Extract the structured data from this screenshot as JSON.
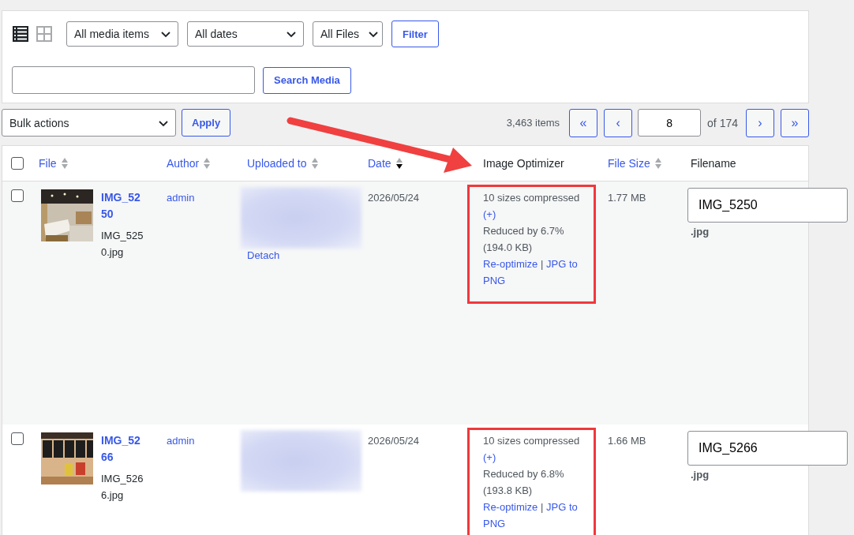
{
  "view_modes": [
    {
      "kind": "list",
      "selected": true
    },
    {
      "kind": "grid",
      "selected": false
    }
  ],
  "filters": {
    "dropdowns": [
      "All media items",
      "All dates",
      "All Files"
    ],
    "filter_button": "Filter",
    "search_button": "Search Media"
  },
  "bulk": {
    "dropdown": "Bulk actions",
    "apply_button": "Apply"
  },
  "pagination": {
    "count": "3,463 items",
    "first": "«",
    "prev": "‹",
    "page": "8",
    "of": "of 174",
    "next": "›",
    "last": "»"
  },
  "annotations": [
    {
      "kind": "arrow"
    }
  ],
  "table": {
    "select_all": {
      "checked": false
    },
    "columns": [
      {
        "label": "File",
        "sortable": true,
        "sorted": false
      },
      {
        "label": "Author",
        "sortable": true,
        "sorted": false
      },
      {
        "label": "Uploaded to",
        "sortable": true,
        "sorted": false
      },
      {
        "label": "Date",
        "sortable": true,
        "sorted": true
      },
      {
        "label": "Image Optimizer",
        "sortable": false
      },
      {
        "label": "File Size",
        "sortable": true,
        "sorted": false
      },
      {
        "label": "Filename",
        "sortable": false
      }
    ],
    "rows": [
      {
        "checked": false,
        "title": "IMG_5250",
        "file": "IMG_5250.jpg",
        "author": "admin",
        "uploaded_to": {
          "kind": "redacted",
          "action": "Detach"
        },
        "date": "2026/05/24",
        "optimizer": {
          "highlighted": true,
          "summary": "10 sizes compressed",
          "details_link": "(+)",
          "reduction": "Reduced by 6.7% (194.0 KB)",
          "actions": [
            "Re-optimize",
            "JPG to PNG"
          ],
          "separator": "|"
        },
        "size": "1.77 MB",
        "filename": {
          "value": "IMG_5250",
          "ext": ".jpg"
        }
      },
      {
        "checked": false,
        "title": "IMG_5266",
        "file": "IMG_5266.jpg",
        "author": "admin",
        "uploaded_to": {
          "kind": "redacted"
        },
        "date": "2026/05/24",
        "optimizer": {
          "highlighted": true,
          "summary": "10 sizes compressed",
          "details_link": "(+)",
          "reduction": "Reduced by 6.8% (193.8 KB)",
          "actions": [
            "Re-optimize",
            "JPG to PNG"
          ],
          "separator": "|"
        },
        "size": "1.66 MB",
        "filename": {
          "value": "IMG_5266",
          "ext": ".jpg"
        }
      }
    ]
  }
}
